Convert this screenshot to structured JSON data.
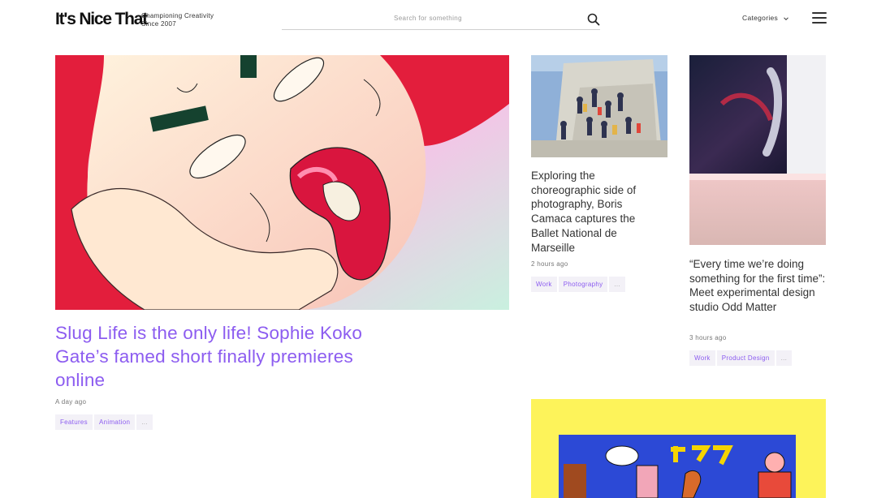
{
  "header": {
    "logo": "It's Nice That",
    "tagline_line1": "Championing Creativity",
    "tagline_line2": "Since 2007",
    "search_placeholder": "Search for something",
    "categories_label": "Categories"
  },
  "hero": {
    "title": "Slug Life is the only life! Sophie Koko Gate’s famed short finally premieres online",
    "time": "A day ago",
    "tags": [
      "Features",
      "Animation",
      "..."
    ]
  },
  "card1": {
    "title": "Exploring the choreographic side of photography, Boris Camaca captures the Ballet National de Marseille",
    "time": "2 hours ago",
    "tags": [
      "Work",
      "Photography",
      "..."
    ]
  },
  "card2": {
    "title": "“Every time we’re doing something for the first time”: Meet experimental design studio Odd Matter",
    "time": "3 hours ago",
    "tags": [
      "Work",
      "Product Design",
      "..."
    ]
  },
  "colors": {
    "accent": "#8c5cf0",
    "tag_bg": "#f3f1f7",
    "promo_bg": "#fdf35a"
  }
}
